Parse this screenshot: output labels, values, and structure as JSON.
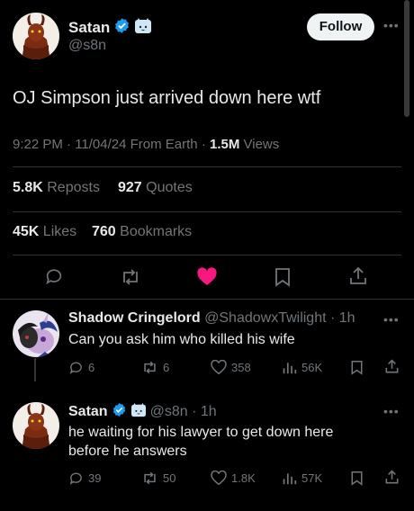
{
  "main_tweet": {
    "author_name": "Satan",
    "handle": "@s8n",
    "follow_label": "Follow",
    "text": "OJ Simpson just arrived down here wtf",
    "time": "9:22 PM · 11/04/24 From Earth · ",
    "views_count": "1.5M",
    "views_label": " Views",
    "reposts_count": "5.8K",
    "reposts_label": " Reposts",
    "quotes_count": "927",
    "quotes_label": " Quotes",
    "likes_count": "45K",
    "likes_label": " Likes",
    "bookmarks_count": "760",
    "bookmarks_label": " Bookmarks",
    "like_color": "#f91880"
  },
  "replies": [
    {
      "author_name": "Shadow Cringelord",
      "handle_time": "@ShadowxTwilight · 1h",
      "text": "Can you ask him who killed his wife",
      "replies": "6",
      "reposts": "6",
      "likes": "358",
      "views": "56K"
    },
    {
      "author_name": "Satan",
      "handle_time": "@s8n · 1h",
      "text": "he waiting for his lawyer to get down here before he answers",
      "replies": "39",
      "reposts": "50",
      "likes": "1.8K",
      "views": "57K"
    }
  ],
  "icons": {
    "verified": "verified-badge-icon",
    "affiliate": "cat-affiliate-icon",
    "more": "more-icon"
  },
  "colors": {
    "verified": "#1d9bf0",
    "accent_like": "#f91880"
  }
}
